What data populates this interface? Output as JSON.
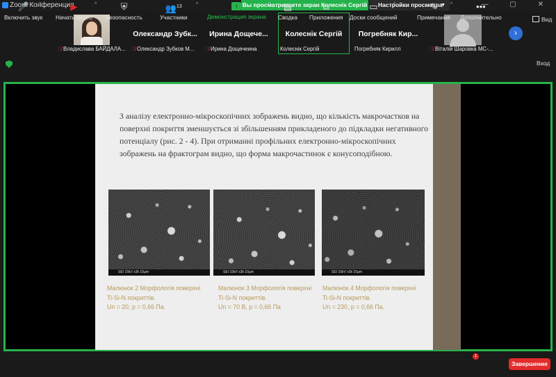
{
  "window": {
    "app_title": "Zoom Конференция",
    "controls": "—  ▢  ✕"
  },
  "share_banner": "Вы просматриваете экран Колеснік Сергій",
  "view_options": "Настройки просмотра",
  "gallery": {
    "view_label": "Вид",
    "participants": [
      {
        "big_name": "",
        "small_name": "Владислава БАЙДАЛА...",
        "muted": true,
        "avatar": "photo"
      },
      {
        "big_name": "Олександр Зубк...",
        "small_name": "Олександр Зубков М...",
        "muted": true,
        "avatar": "none"
      },
      {
        "big_name": "Ирина Дощече...",
        "small_name": "Ирина Дощечеина",
        "muted": true,
        "avatar": "none"
      },
      {
        "big_name": "Колеснік Сергій",
        "small_name": "Колеснік Сергій",
        "muted": false,
        "avatar": "none"
      },
      {
        "big_name": "Погребняк Кир...",
        "small_name": "Погребняк Кирилл",
        "muted": false,
        "avatar": "none"
      },
      {
        "big_name": "",
        "small_name": "Віталій Шаровка МС-...",
        "muted": true,
        "avatar": "generic"
      }
    ]
  },
  "exit_label": "Вход",
  "slide": {
    "text": "З аналізу електронно-мікроскопічних зображень видно, що кількість макрочастков на поверхні покриття зменшується зі збільшенням прикладеного до підкладки негативного потенціалу (рис. 2 - 4). При отриманні профільних електронно-мікроскопічних зображень на фрактограм видно, що форма макрочастинок є конусоподібною.",
    "images": [
      {
        "scale_text": "SEI  15kV    x3k   10µm"
      },
      {
        "scale_text": "SEI  15kV    x3k   10µm"
      },
      {
        "scale_text": "SEI  15kV    x3k   10µm"
      }
    ],
    "captions": [
      [
        "Малюнок 2 Морфологія поверхні",
        "Ti-Si-N покриттів.",
        "Un = 20, p = 0,66 Па."
      ],
      [
        "Малюнок 3 Морфологія поверхні",
        "Ti-Si-N покриттів.",
        "Un = 70 В, p = 0,66 Па"
      ],
      [
        "Малюнок 4 Морфологія поверхні",
        "Ti-Si-N покриттів.",
        "Un = 230, p = 0,66 Па."
      ]
    ]
  },
  "toolbar": {
    "audio": "Включить звук",
    "video": "Начать видео",
    "security": "Безопасность",
    "participants": "Участники",
    "participants_count": "13",
    "share": "Демонстрация экрана",
    "summary": "Сводка",
    "apps": "Приложения",
    "whiteboards": "Доски сообщений",
    "notes": "Примечания",
    "more": "Дополнительно",
    "more_badge": "1",
    "end": "Завершение"
  },
  "colors": {
    "accent_green": "#27b34a",
    "danger_red": "#e22b2b",
    "caption_gold": "#b79a5a"
  }
}
